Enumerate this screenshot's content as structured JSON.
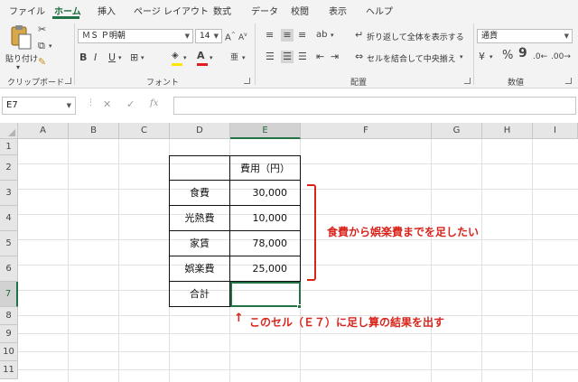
{
  "menu": {
    "items": [
      "ファイル",
      "ホーム",
      "挿入",
      "ページ レイアウト",
      "数式",
      "データ",
      "校閲",
      "表示",
      "ヘルプ"
    ],
    "active_index": 1
  },
  "ribbon": {
    "clipboard": {
      "paste_label": "貼り付け",
      "group_label": "クリップボード"
    },
    "font": {
      "font_name": "ＭＳ Ｐ明朝",
      "font_size": "14",
      "group_label": "フォント"
    },
    "alignment": {
      "wrap_text": "折り返して全体を表示する",
      "merge_center": "セルを結合して中央揃え",
      "group_label": "配置"
    },
    "number": {
      "format": "通貨",
      "group_label": "数値"
    }
  },
  "formula_bar": {
    "name_box": "E7",
    "fx": "fx",
    "formula": ""
  },
  "columns": [
    "A",
    "B",
    "C",
    "D",
    "E",
    "F",
    "G",
    "H",
    "I"
  ],
  "rows": [
    "1",
    "2",
    "3",
    "4",
    "5",
    "6",
    "7",
    "8",
    "9",
    "10",
    "11"
  ],
  "table": {
    "header": "費用（円）",
    "items": [
      {
        "label": "食費",
        "value": "30,000"
      },
      {
        "label": "光熱費",
        "value": "10,000"
      },
      {
        "label": "家賃",
        "value": "78,000"
      },
      {
        "label": "娯楽費",
        "value": "25,000"
      }
    ],
    "total_label": "合計",
    "total_value": ""
  },
  "annotations": {
    "bracket_note": "食費から娯楽費までを足したい",
    "cell_note": "このセル（Ｅ７）に足し算の結果を出す",
    "color": "#d9241c"
  },
  "colors": {
    "excel_green": "#217346"
  }
}
